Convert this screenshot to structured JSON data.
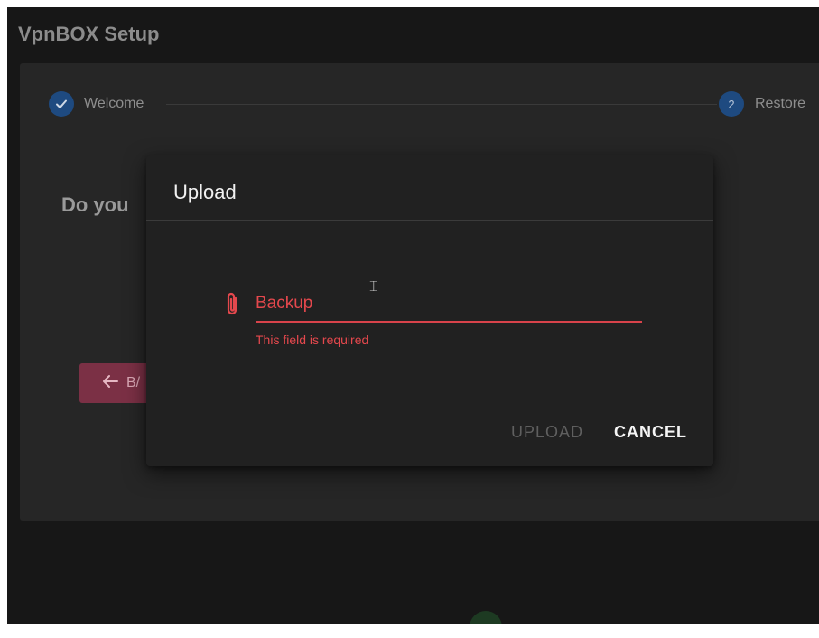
{
  "app": {
    "title": "VpnBOX Setup"
  },
  "stepper": {
    "steps": [
      {
        "label": "Welcome",
        "state": "complete",
        "icon": "check-icon"
      },
      {
        "label": "Restore",
        "number": "2",
        "state": "active"
      }
    ]
  },
  "main": {
    "question": "Do you",
    "back_label": "B/"
  },
  "dialog": {
    "title": "Upload",
    "field": {
      "icon": "paperclip-icon",
      "label": "Backup",
      "value": "",
      "error": "This field is required"
    },
    "actions": {
      "upload_label": "UPLOAD",
      "cancel_label": "CANCEL"
    }
  },
  "colors": {
    "accent_blue": "#1e4a80",
    "error_red": "#e5484d",
    "back_button": "#7b3045",
    "dialog_bg": "#212121",
    "app_bg": "#171717"
  }
}
